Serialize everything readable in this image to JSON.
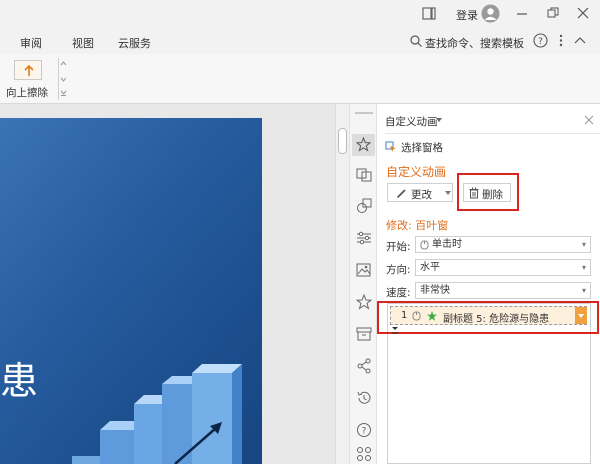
{
  "titlebar": {
    "login_label": "登录"
  },
  "menubar": {
    "items": [
      "审阅",
      "视图",
      "云服务"
    ],
    "search_label": "查找命令、搜索模板"
  },
  "ribbon": {
    "wipe_up_label": "向上擦除"
  },
  "slide": {
    "big_char": "患"
  },
  "panel": {
    "title": "自定义动画",
    "select_pane": "选择窗格",
    "section_title": "自定义动画",
    "change_label": "更改",
    "delete_label": "删除",
    "modify_label": "修改: 百叶窗",
    "start_label": "开始:",
    "start_value": "单击时",
    "direction_label": "方向:",
    "direction_value": "水平",
    "speed_label": "速度:",
    "speed_value": "非常快",
    "anim_item": {
      "index": "1",
      "text": "副标题 5: 危险源与隐患"
    }
  },
  "colors": {
    "accent_orange": "#e06c1a",
    "highlight_red": "#d9251d",
    "slide_blue": "#1f5597"
  }
}
